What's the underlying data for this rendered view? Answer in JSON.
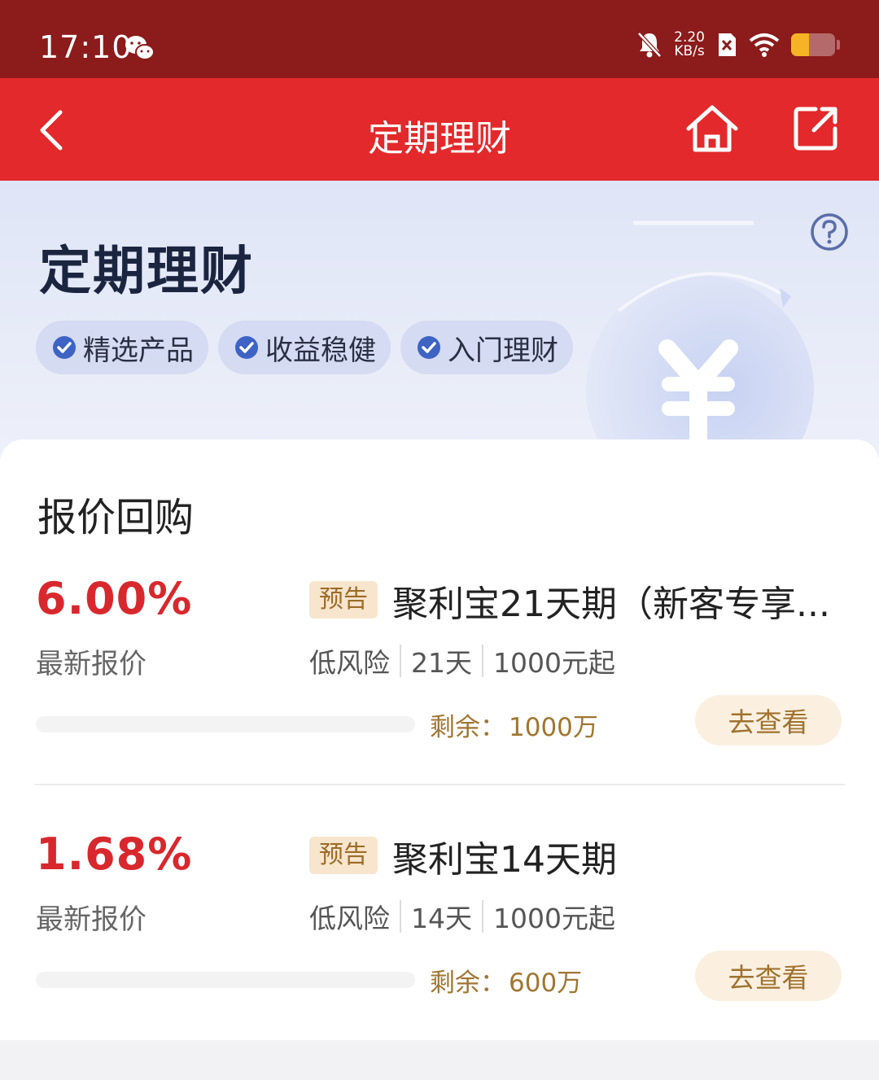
{
  "status_bar": {
    "time": "17:10",
    "net_speed_value": "2.20",
    "net_speed_unit": "KB/s",
    "battery_level": 0.4,
    "icons": [
      "wechat-icon",
      "bell-muted-icon",
      "sim-x-icon",
      "wifi-icon",
      "battery-icon"
    ]
  },
  "nav": {
    "title": "定期理财",
    "icons": [
      "back-icon",
      "home-icon",
      "share-icon"
    ]
  },
  "banner": {
    "title": "定期理财",
    "tags": [
      {
        "label": "精选产品"
      },
      {
        "label": "收益稳健"
      },
      {
        "label": "入门理财"
      }
    ],
    "icons": [
      "help-icon",
      "yuan-bag-icon"
    ]
  },
  "section": {
    "title": "报价回购",
    "products": [
      {
        "rate": "6.00%",
        "rate_label": "最新报价",
        "badge": "预告",
        "name": "聚利宝21天期（新客专享...",
        "risk": "低风险",
        "term": "21天",
        "min_amount": "1000元起",
        "remain_label": "剩余：",
        "remain_value": "1000万",
        "progress": 0,
        "button": "去查看"
      },
      {
        "rate": "1.68%",
        "rate_label": "最新报价",
        "badge": "预告",
        "name": "聚利宝14天期",
        "risk": "低风险",
        "term": "14天",
        "min_amount": "1000元起",
        "remain_label": "剩余：",
        "remain_value": "600万",
        "progress": 0,
        "button": "去查看"
      }
    ]
  },
  "colors": {
    "status_bar": "#8c1b1b",
    "nav_bar": "#e3292b",
    "rate": "#d8282d",
    "accent_gold": "#a07632"
  }
}
